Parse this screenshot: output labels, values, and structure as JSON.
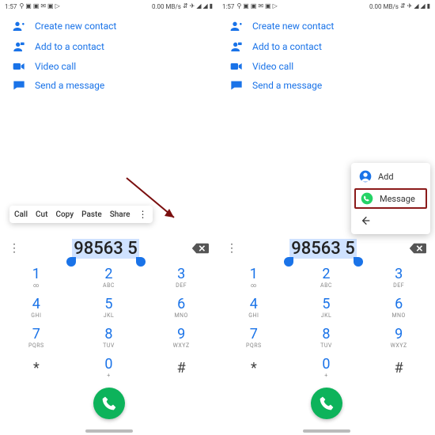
{
  "status": {
    "time": "1:57",
    "net": "0.00 MB/s"
  },
  "actions": {
    "create": "Create new contact",
    "add": "Add to a contact",
    "video": "Video call",
    "message": "Send a message"
  },
  "dialer": {
    "number": "98563 5"
  },
  "keypad": [
    {
      "d": "1",
      "l": "∞"
    },
    {
      "d": "2",
      "l": "ABC"
    },
    {
      "d": "3",
      "l": "DEF"
    },
    {
      "d": "4",
      "l": "GHI"
    },
    {
      "d": "5",
      "l": "JKL"
    },
    {
      "d": "6",
      "l": "MNO"
    },
    {
      "d": "7",
      "l": "PQRS"
    },
    {
      "d": "8",
      "l": "TUV"
    },
    {
      "d": "9",
      "l": "WXYZ"
    }
  ],
  "symbols": {
    "star": "*",
    "zero": "0",
    "plus": "+",
    "hash": "#"
  },
  "selection_toolbar": {
    "call": "Call",
    "cut": "Cut",
    "copy": "Copy",
    "paste": "Paste",
    "share": "Share"
  },
  "ext_menu": {
    "add": "Add",
    "message": "Message"
  },
  "colors": {
    "accent": "#1a73e8",
    "call": "#0db35b",
    "whatsapp": "#25D366",
    "highlight_border": "#8b1a1a"
  }
}
